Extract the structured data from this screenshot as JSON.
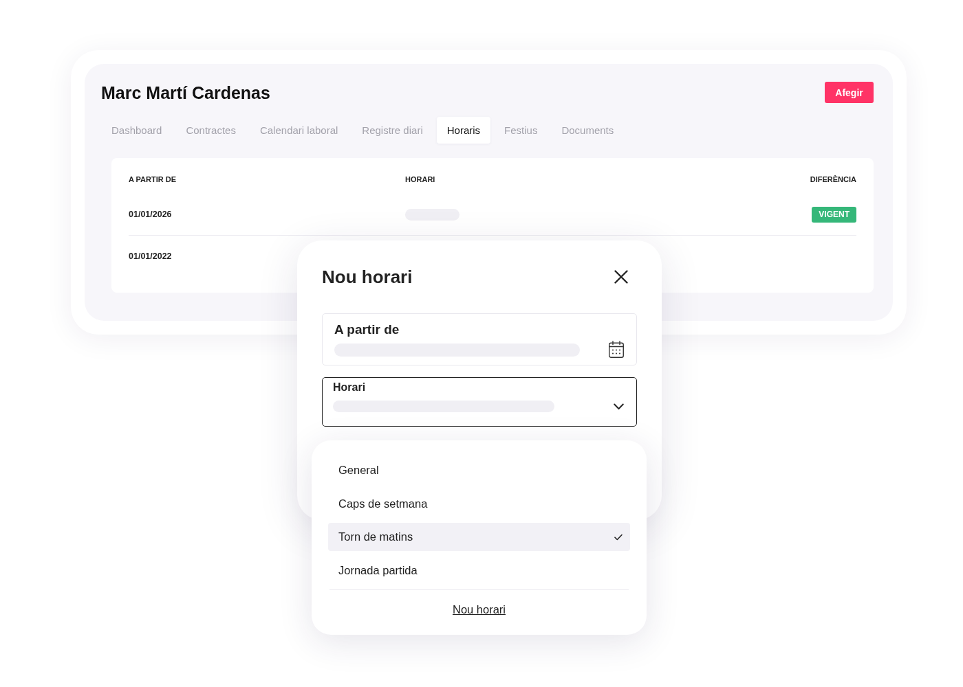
{
  "header": {
    "title": "Marc Martí Cardenas",
    "add_button": "Afegir"
  },
  "tabs": [
    {
      "label": "Dashboard",
      "selected": false
    },
    {
      "label": "Contractes",
      "selected": false
    },
    {
      "label": "Calendari laboral",
      "selected": false
    },
    {
      "label": "Registre diari",
      "selected": false
    },
    {
      "label": "Horaris",
      "selected": true
    },
    {
      "label": "Festius",
      "selected": false
    },
    {
      "label": "Documents",
      "selected": false
    }
  ],
  "table": {
    "columns": [
      "A PARTIR DE",
      "HORARI",
      "DIFERÈNCIA"
    ],
    "rows": [
      {
        "from": "01/01/2026",
        "horari_loading": true,
        "status": "VIGENT"
      },
      {
        "from": "01/01/2022"
      }
    ]
  },
  "modal": {
    "title": "Nou horari",
    "fields": [
      {
        "kind": "date",
        "label": "A partir de",
        "focused": false,
        "loading": true
      },
      {
        "kind": "select",
        "label": "Horari",
        "focused": true,
        "loading": true
      }
    ]
  },
  "dropdown": {
    "options": [
      {
        "label": "General",
        "selected": false
      },
      {
        "label": "Caps de setmana",
        "selected": false
      },
      {
        "label": "Torn de matins",
        "selected": true
      },
      {
        "label": "Jornada partida",
        "selected": false
      }
    ],
    "footer_link": "Nou horari"
  }
}
